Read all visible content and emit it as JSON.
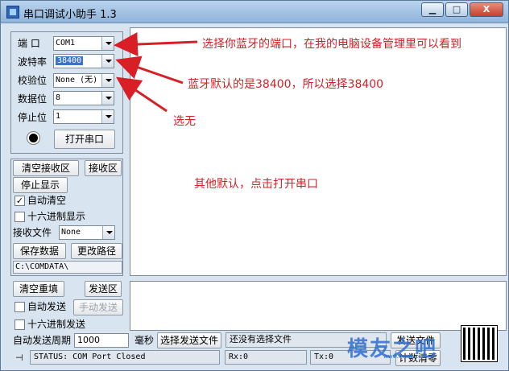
{
  "window": {
    "title": "串口调试小助手 1.3",
    "btn_min": "▁",
    "btn_max": "□",
    "btn_close": "X"
  },
  "port": {
    "port_label": "端  口",
    "port_value": "COM1",
    "baud_label": "波特率",
    "baud_value": "38400",
    "parity_label": "校验位",
    "parity_value": "None (无)",
    "databits_label": "数据位",
    "databits_value": "8",
    "stopbits_label": "停止位",
    "stopbits_value": "1",
    "open_button": "打开串口"
  },
  "receive": {
    "clear_button": "清空接收区",
    "area_label": "接收区",
    "stop_button": "停止显示",
    "auto_clear": "自动清空",
    "auto_clear_checked": true,
    "hex_display": "十六进制显示",
    "hex_display_checked": false,
    "file_label": "接收文件",
    "file_value": "None",
    "save_button": "保存数据",
    "change_path_button": "更改路径",
    "path": "C:\\COMDATA\\"
  },
  "send": {
    "clear_button": "清空重填",
    "area_label": "发送区",
    "auto_send": "自动发送",
    "auto_send_checked": false,
    "manual_button": "手动发送",
    "hex_send": "十六进制发送",
    "hex_send_checked": false,
    "period_label": "自动发送周期",
    "period_value": "1000",
    "ms_label": "毫秒",
    "choose_file_button": "选择发送文件",
    "file_status": "还没有选择文件",
    "send_file_button": "发送文件"
  },
  "statusbar": {
    "status": "STATUS: COM Port Closed",
    "rx": "Rx:0",
    "tx": "Tx:0",
    "reset_button": "计数清零"
  },
  "annotations": {
    "a1": "选择你蓝牙的端口，在我的电脑设备管理里可以看到",
    "a2": "蓝牙默认的是38400，所以选择38400",
    "a3": "选无",
    "a4": "其他默认，点击打开串口"
  },
  "watermark": {
    "text": "模友之吧",
    "url": "www.mozs.com"
  },
  "colors": {
    "annotation": "#d81f26",
    "watermark": "#2f6fd1"
  }
}
